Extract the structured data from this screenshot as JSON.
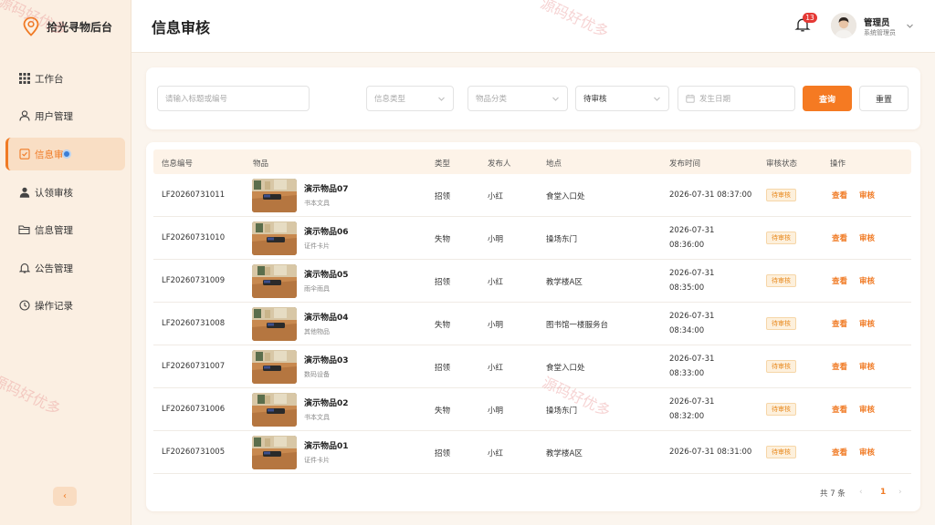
{
  "app": {
    "title": "拾光寻物后台"
  },
  "sidebar": {
    "items": [
      {
        "label": "工作台",
        "icon": "grid-icon"
      },
      {
        "label": "用户管理",
        "icon": "user-icon"
      },
      {
        "label": "信息审",
        "icon": "audit-icon",
        "active": true
      },
      {
        "label": "认领审核",
        "icon": "person-icon"
      },
      {
        "label": "信息管理",
        "icon": "folder-icon"
      },
      {
        "label": "公告管理",
        "icon": "bell-icon"
      },
      {
        "label": "操作记录",
        "icon": "clock-icon"
      }
    ],
    "collapse_label": "‹"
  },
  "header": {
    "page_title": "信息审核",
    "notification_count": "13",
    "user_name": "管理员",
    "user_role": "系统管理员"
  },
  "filters": {
    "keyword_placeholder": "请输入标题或编号",
    "info_type_placeholder": "信息类型",
    "category_placeholder": "物品分类",
    "status_value": "待审核",
    "date_placeholder": "发生日期",
    "query_label": "查询",
    "reset_label": "重置"
  },
  "table": {
    "headers": {
      "id": "信息编号",
      "item": "物品",
      "type": "类型",
      "publisher": "发布人",
      "location": "地点",
      "time": "发布时间",
      "status": "审核状态",
      "actions": "操作"
    },
    "view_label": "查看",
    "audit_label": "审核",
    "rows": [
      {
        "id": "LF20260731011",
        "name": "演示物品07",
        "category": "书本文具",
        "type": "招领",
        "publisher": "小红",
        "location": "食堂入口处",
        "time_line1": "2026-07-31 08:37:00",
        "time_line2": "",
        "status": "待审核"
      },
      {
        "id": "LF20260731010",
        "name": "演示物品06",
        "category": "证件卡片",
        "type": "失物",
        "publisher": "小明",
        "location": "操场东门",
        "time_line1": "2026-07-31",
        "time_line2": "08:36:00",
        "status": "待审核"
      },
      {
        "id": "LF20260731009",
        "name": "演示物品05",
        "category": "雨伞雨具",
        "type": "招领",
        "publisher": "小红",
        "location": "教学楼A区",
        "time_line1": "2026-07-31",
        "time_line2": "08:35:00",
        "status": "待审核"
      },
      {
        "id": "LF20260731008",
        "name": "演示物品04",
        "category": "其他物品",
        "type": "失物",
        "publisher": "小明",
        "location": "图书馆一楼服务台",
        "time_line1": "2026-07-31",
        "time_line2": "08:34:00",
        "status": "待审核"
      },
      {
        "id": "LF20260731007",
        "name": "演示物品03",
        "category": "数码设备",
        "type": "招领",
        "publisher": "小红",
        "location": "食堂入口处",
        "time_line1": "2026-07-31",
        "time_line2": "08:33:00",
        "status": "待审核"
      },
      {
        "id": "LF20260731006",
        "name": "演示物品02",
        "category": "书本文具",
        "type": "失物",
        "publisher": "小明",
        "location": "操场东门",
        "time_line1": "2026-07-31",
        "time_line2": "08:32:00",
        "status": "待审核"
      },
      {
        "id": "LF20260731005",
        "name": "演示物品01",
        "category": "证件卡片",
        "type": "招领",
        "publisher": "小红",
        "location": "教学楼A区",
        "time_line1": "2026-07-31 08:31:00",
        "time_line2": "",
        "status": "待审核"
      }
    ]
  },
  "pagination": {
    "total_label": "共 7 条",
    "prev": "‹",
    "current_page": "1",
    "next": "›"
  },
  "watermark": {
    "text": "源码好优多"
  },
  "colors": {
    "accent": "#f57a22",
    "sidebar_bg": "#fbefe2",
    "status_bg": "#fdf0dc",
    "status_text": "#e8891e",
    "badge": "#e53935"
  }
}
